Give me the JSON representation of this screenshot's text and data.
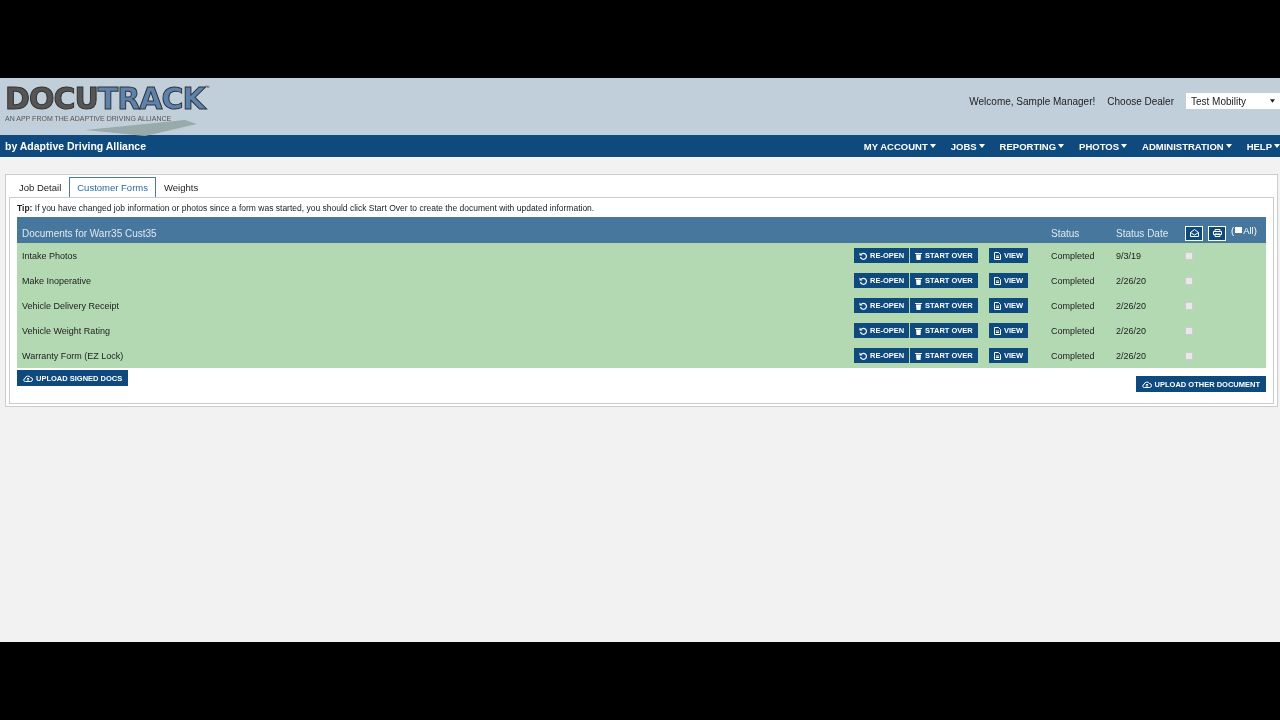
{
  "logo": {
    "wordmark_dark": "DOCU",
    "wordmark_light": "TRACK",
    "trademark": "™",
    "tagline": "AN APP FROM THE ADAPTIVE DRIVING ALLIANCE"
  },
  "header": {
    "welcome": "Welcome, Sample Manager!",
    "dealer_label": "Choose Dealer",
    "dealer_value": "Test Mobility"
  },
  "navbar": {
    "brand": "by Adaptive Driving Alliance",
    "items": [
      "MY ACCOUNT",
      "JOBS",
      "REPORTING",
      "PHOTOS",
      "ADMINISTRATION",
      "HELP"
    ]
  },
  "tabs": [
    {
      "label": "Job Detail",
      "selected": false
    },
    {
      "label": "Customer Forms",
      "selected": true
    },
    {
      "label": "Weights",
      "selected": false
    }
  ],
  "tip": "**Tip:** If you have changed job information or photos since a form was started, you should click Start Over to create the document with updated information.",
  "table": {
    "title": "Documents for Warr35 Cust35",
    "columns": [
      "Status",
      "Status Date"
    ],
    "select_all": {
      "prefix": "(",
      "label": "All)"
    },
    "rows": [
      {
        "name": "Intake Photos",
        "actions": [
          {
            "kind": "reopen",
            "label": "RE-OPEN"
          },
          {
            "kind": "startover",
            "label": "START OVER"
          },
          {
            "kind": "view",
            "label": "VIEW"
          }
        ],
        "status": "Completed",
        "date": "9/3/19",
        "checked": false
      },
      {
        "name": "Make Inoperative",
        "actions": [
          {
            "kind": "reopen",
            "label": "RE-OPEN"
          },
          {
            "kind": "startover",
            "label": "START OVER"
          },
          {
            "kind": "view",
            "label": "VIEW"
          }
        ],
        "status": "Completed",
        "date": "2/26/20",
        "checked": false
      },
      {
        "name": "Vehicle Delivery Receipt",
        "actions": [
          {
            "kind": "reopen",
            "label": "RE-OPEN"
          },
          {
            "kind": "startover",
            "label": "START OVER"
          },
          {
            "kind": "view",
            "label": "VIEW"
          }
        ],
        "status": "Completed",
        "date": "2/26/20",
        "checked": false
      },
      {
        "name": "Vehicle Weight Rating",
        "actions": [
          {
            "kind": "reopen",
            "label": "RE-OPEN"
          },
          {
            "kind": "startover",
            "label": "START OVER"
          },
          {
            "kind": "view",
            "label": "VIEW"
          }
        ],
        "status": "Completed",
        "date": "2/26/20",
        "checked": false
      },
      {
        "name": "Warranty Form (EZ Lock)",
        "actions": [
          {
            "kind": "reopen",
            "label": "RE-OPEN"
          },
          {
            "kind": "startover",
            "label": "START OVER"
          },
          {
            "kind": "view",
            "label": "VIEW"
          }
        ],
        "status": "Completed",
        "date": "2/26/20",
        "checked": false
      }
    ]
  },
  "upload_signed": "UPLOAD SIGNED DOCS",
  "upload_other": "UPLOAD OTHER DOCUMENT"
}
